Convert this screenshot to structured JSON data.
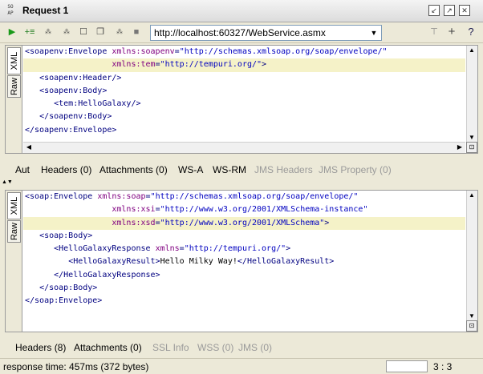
{
  "window": {
    "title": "Request 1",
    "icon_text": [
      "SO",
      "AP"
    ]
  },
  "toolbar": {
    "endpoint_url": "http://localhost:60327/WebService.asmx"
  },
  "request": {
    "side_tabs": [
      "XML",
      "Raw"
    ],
    "lines": [
      {
        "indent": "",
        "parts": [
          {
            "c": "t",
            "s": "<soapenv:Envelope "
          },
          {
            "c": "a",
            "s": "xmlns:soapenv"
          },
          {
            "c": "t",
            "s": "="
          },
          {
            "c": "v",
            "s": "\"http://schemas.xmlsoap.org/soap/envelope/\""
          }
        ]
      },
      {
        "indent": "                  ",
        "hl": true,
        "parts": [
          {
            "c": "a",
            "s": "xmlns:tem"
          },
          {
            "c": "t",
            "s": "="
          },
          {
            "c": "v",
            "s": "\"http://tempuri.org/\""
          },
          {
            "c": "t",
            "s": ">"
          }
        ]
      },
      {
        "indent": "   ",
        "parts": [
          {
            "c": "t",
            "s": "<soapenv:Header/>"
          }
        ]
      },
      {
        "indent": "   ",
        "parts": [
          {
            "c": "t",
            "s": "<soapenv:Body>"
          }
        ]
      },
      {
        "indent": "      ",
        "parts": [
          {
            "c": "t",
            "s": "<tem:HelloGalaxy/>"
          }
        ]
      },
      {
        "indent": "   ",
        "parts": [
          {
            "c": "t",
            "s": "</soapenv:Body>"
          }
        ]
      },
      {
        "indent": "",
        "parts": [
          {
            "c": "t",
            "s": "</soapenv:Envelope>"
          }
        ]
      }
    ],
    "tabs": [
      {
        "label": "Aut",
        "disabled": false
      },
      {
        "label": "Headers (0)",
        "disabled": false
      },
      {
        "label": "Attachments (0)",
        "disabled": false
      },
      {
        "label": "WS-A",
        "disabled": false
      },
      {
        "label": "WS-RM",
        "disabled": false
      },
      {
        "label": "JMS Headers",
        "disabled": true
      },
      {
        "label": "JMS Property (0)",
        "disabled": true
      }
    ]
  },
  "response": {
    "side_tabs": [
      "XML",
      "Raw"
    ],
    "lines": [
      {
        "indent": "",
        "parts": [
          {
            "c": "t",
            "s": "<soap:Envelope "
          },
          {
            "c": "a",
            "s": "xmlns:soap"
          },
          {
            "c": "t",
            "s": "="
          },
          {
            "c": "v",
            "s": "\"http://schemas.xmlsoap.org/soap/envelope/\""
          }
        ]
      },
      {
        "indent": "                  ",
        "parts": [
          {
            "c": "a",
            "s": "xmlns:xsi"
          },
          {
            "c": "t",
            "s": "="
          },
          {
            "c": "v",
            "s": "\"http://www.w3.org/2001/XMLSchema-instance\""
          }
        ]
      },
      {
        "indent": "                  ",
        "hl": true,
        "parts": [
          {
            "c": "a",
            "s": "xmlns:xsd"
          },
          {
            "c": "t",
            "s": "="
          },
          {
            "c": "v",
            "s": "\"http://www.w3.org/2001/XMLSchema\""
          },
          {
            "c": "t",
            "s": ">"
          }
        ]
      },
      {
        "indent": "   ",
        "parts": [
          {
            "c": "t",
            "s": "<soap:Body>"
          }
        ]
      },
      {
        "indent": "      ",
        "parts": [
          {
            "c": "t",
            "s": "<HelloGalaxyResponse "
          },
          {
            "c": "a",
            "s": "xmlns"
          },
          {
            "c": "t",
            "s": "="
          },
          {
            "c": "v",
            "s": "\"http://tempuri.org/\""
          },
          {
            "c": "t",
            "s": ">"
          }
        ]
      },
      {
        "indent": "         ",
        "parts": [
          {
            "c": "t",
            "s": "<HelloGalaxyResult>"
          },
          {
            "c": "x",
            "s": "Hello Milky Way!"
          },
          {
            "c": "t",
            "s": "</HelloGalaxyResult>"
          }
        ]
      },
      {
        "indent": "      ",
        "parts": [
          {
            "c": "t",
            "s": "</HelloGalaxyResponse>"
          }
        ]
      },
      {
        "indent": "   ",
        "parts": [
          {
            "c": "t",
            "s": "</soap:Body>"
          }
        ]
      },
      {
        "indent": "",
        "parts": [
          {
            "c": "t",
            "s": "</soap:Envelope>"
          }
        ]
      }
    ],
    "tabs": [
      {
        "label": "Headers (8)",
        "disabled": false
      },
      {
        "label": "Attachments (0)",
        "disabled": false
      },
      {
        "label": "SSL Info",
        "disabled": true
      },
      {
        "label": "WSS (0)",
        "disabled": true
      },
      {
        "label": "JMS (0)",
        "disabled": true
      }
    ]
  },
  "status": {
    "response_time": "response time: 457ms (372 bytes)",
    "caret_position": "3 : 3"
  },
  "colors": {
    "tag": "#000080",
    "attribute": "#800080",
    "value": "#0000c0",
    "highlight": "#f5f2c8"
  }
}
